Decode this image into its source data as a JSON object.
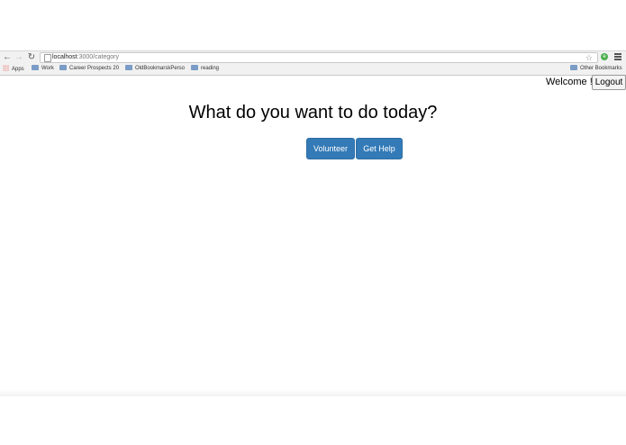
{
  "browser": {
    "url_host": "localhost",
    "url_path": ":3000/category",
    "bookmarks": [
      {
        "label": "Apps",
        "icon": "apps-grid-icon"
      },
      {
        "label": "Work",
        "icon": "folder-icon"
      },
      {
        "label": "Career Prospects 20",
        "icon": "folder-icon"
      },
      {
        "label": "OldBookmarskPerso",
        "icon": "folder-icon"
      },
      {
        "label": "reading",
        "icon": "folder-icon"
      }
    ],
    "other_bookmarks": "Other Bookmarks"
  },
  "header": {
    "welcome": "Welcome !!",
    "logout_label": "Logout"
  },
  "main": {
    "heading": "What do you want to do today?",
    "volunteer_label": "Volunteer",
    "get_help_label": "Get Help"
  },
  "colors": {
    "primary_button": "#337ab7",
    "toolbar_bg": "#f1f1f1"
  }
}
